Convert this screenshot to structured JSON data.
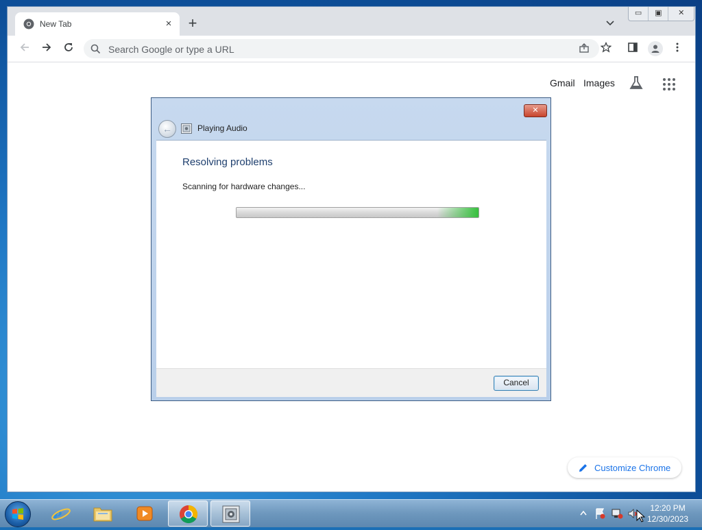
{
  "browser": {
    "tab": {
      "title": "New Tab",
      "close": "×"
    },
    "new_tab": "+",
    "window_controls": {
      "minimize": "▭",
      "maximize": "▣",
      "close": "✕"
    },
    "omnibox": {
      "placeholder": "Search Google or type a URL"
    },
    "ntp": {
      "links": [
        "Gmail",
        "Images"
      ],
      "customize_label": "Customize Chrome"
    }
  },
  "dialog": {
    "title": "Playing Audio",
    "close": "✕",
    "heading": "Resolving problems",
    "status": "Scanning for hardware changes...",
    "cancel_label": "Cancel"
  },
  "taskbar": {
    "clock_time": "12:20 PM",
    "clock_date": "12/30/2023"
  }
}
